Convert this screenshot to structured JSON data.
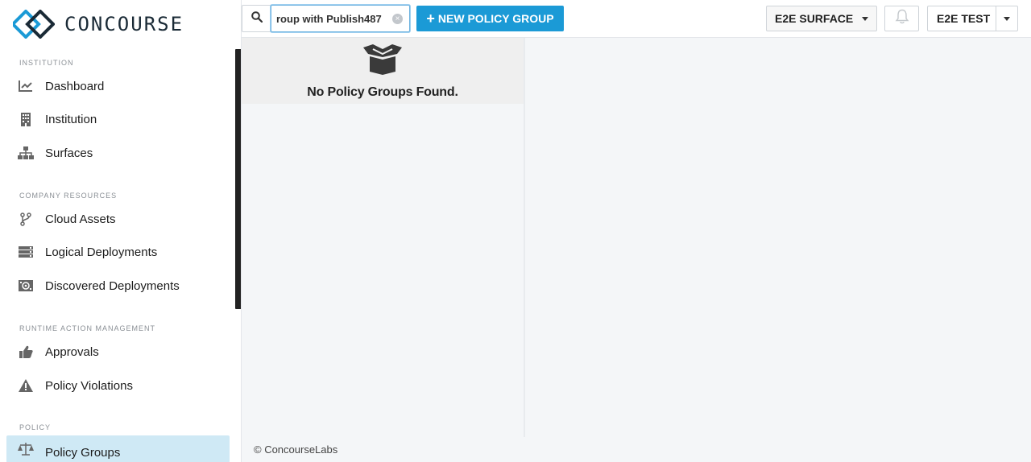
{
  "brand": {
    "name": "CONCOURSE"
  },
  "sidebar": {
    "sections": [
      {
        "title": "INSTITUTION"
      },
      {
        "title": "COMPANY RESOURCES"
      },
      {
        "title": "RUNTIME ACTION MANAGEMENT"
      },
      {
        "title": "POLICY"
      }
    ],
    "items": [
      {
        "label": "Dashboard",
        "icon": "chart-line-icon"
      },
      {
        "label": "Institution",
        "icon": "building-icon"
      },
      {
        "label": "Surfaces",
        "icon": "sitemap-icon"
      },
      {
        "label": "Cloud Assets",
        "icon": "branch-icon"
      },
      {
        "label": "Logical Deployments",
        "icon": "server-icon"
      },
      {
        "label": "Discovered Deployments",
        "icon": "radar-icon"
      },
      {
        "label": "Approvals",
        "icon": "thumbs-up-icon"
      },
      {
        "label": "Policy Violations",
        "icon": "warning-icon"
      },
      {
        "label": "Policy Groups",
        "icon": "balance-scale-icon",
        "active": true
      }
    ]
  },
  "topbar": {
    "search_value": "roup with Publish487",
    "new_button_label": "NEW POLICY GROUP",
    "surface_dropdown": "E2E SURFACE",
    "user_dropdown": "E2E TEST"
  },
  "main": {
    "empty_message": "No Policy Groups Found."
  },
  "footer": {
    "text": "© ConcourseLabs"
  },
  "colors": {
    "accent": "#1b9ad6",
    "active_nav": "#cfe9f5"
  }
}
